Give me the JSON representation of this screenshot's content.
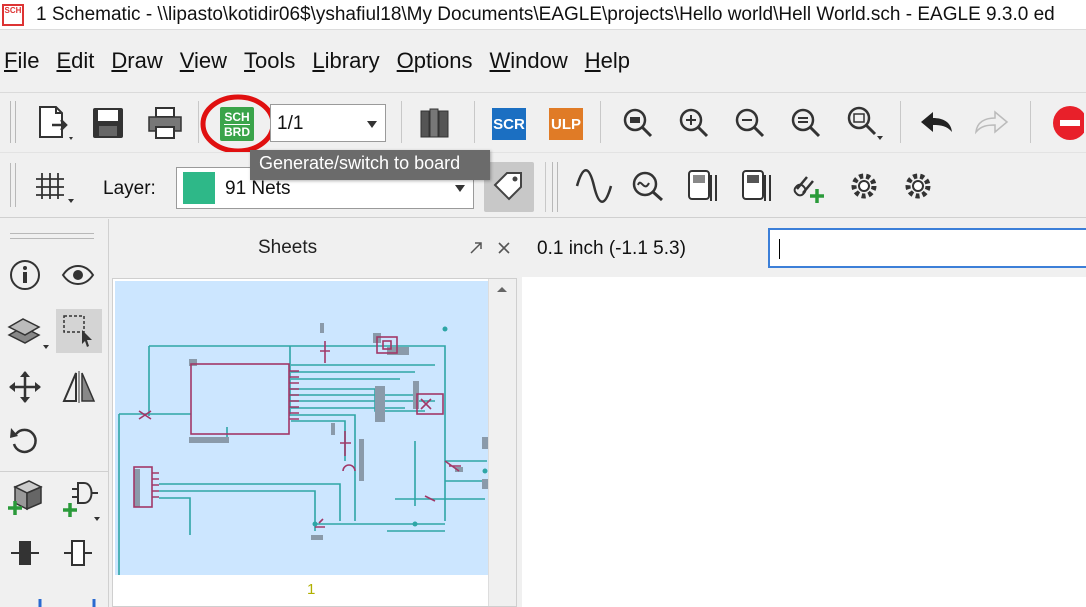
{
  "window": {
    "title": "1 Schematic - \\\\lipasto\\kotidir06$\\yshafiul18\\My Documents\\EAGLE\\projects\\Hello world\\Hell World.sch - EAGLE 9.3.0 ed",
    "app_icon_text": "SCH"
  },
  "menu": {
    "items": [
      {
        "u": "F",
        "rest": "ile"
      },
      {
        "u": "E",
        "rest": "dit"
      },
      {
        "u": "D",
        "rest": "raw"
      },
      {
        "u": "V",
        "rest": "iew"
      },
      {
        "u": "T",
        "rest": "ools"
      },
      {
        "u": "L",
        "rest": "ibrary"
      },
      {
        "u": "O",
        "rest": "ptions"
      },
      {
        "u": "W",
        "rest": "indow"
      },
      {
        "u": "H",
        "rest": "elp"
      }
    ]
  },
  "toolbar": {
    "sheet_select": "1/1",
    "scr_label": "SCR",
    "ulp_label": "ULP",
    "sch_label": "SCH",
    "brd_label": "BRD",
    "layer_label": "Layer:",
    "layer_value": "91 Nets",
    "layer_color": "#2eb888",
    "tooltip": "Generate/switch to board",
    "highlight_color": "#e01010"
  },
  "sheets": {
    "title": "Sheets",
    "page_number": "1"
  },
  "command": {
    "coords": "0.1 inch (-1.1 5.3)",
    "input_value": ""
  }
}
